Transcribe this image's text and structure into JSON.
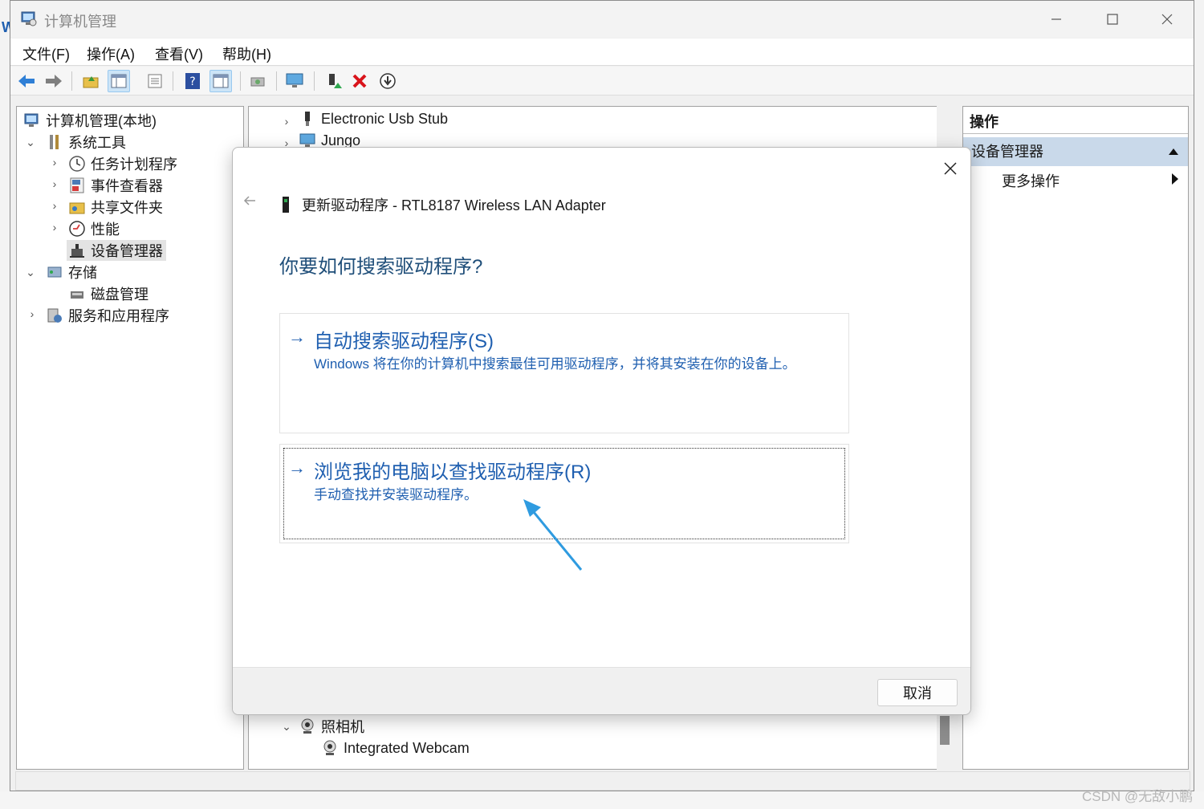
{
  "window": {
    "title": "计算机管理",
    "menu": [
      "文件(F)",
      "操作(A)",
      "查看(V)",
      "帮助(H)"
    ]
  },
  "tree": {
    "root": "计算机管理(本地)",
    "system_tools": "系统工具",
    "task_scheduler": "任务计划程序",
    "event_viewer": "事件查看器",
    "shared_folders": "共享文件夹",
    "performance": "性能",
    "device_manager": "设备管理器",
    "storage": "存储",
    "disk_management": "磁盘管理",
    "services_apps": "服务和应用程序"
  },
  "device_list": {
    "items_top": [
      "Electronic Usb Stub",
      "Jungo"
    ],
    "camera_group": "照相机",
    "camera_item": "Integrated Webcam"
  },
  "actions": {
    "header": "操作",
    "section": "设备管理器",
    "more": "更多操作"
  },
  "dialog": {
    "header": "更新驱动程序 - RTL8187 Wireless LAN Adapter",
    "question": "你要如何搜索驱动程序?",
    "option_auto": {
      "title": "自动搜索驱动程序(S)",
      "desc": "Windows 将在你的计算机中搜索最佳可用驱动程序，并将其安装在你的设备上。"
    },
    "option_browse": {
      "title": "浏览我的电脑以查找驱动程序(R)",
      "desc": "手动查找并安装驱动程序。"
    },
    "cancel": "取消"
  },
  "watermark": "CSDN @无敌小鹏",
  "colors": {
    "link_blue": "#1f5fb0",
    "question_blue": "#1f4e79",
    "annotation_arrow": "#2f9be0",
    "actions_section_bg": "#c9d9ea"
  }
}
